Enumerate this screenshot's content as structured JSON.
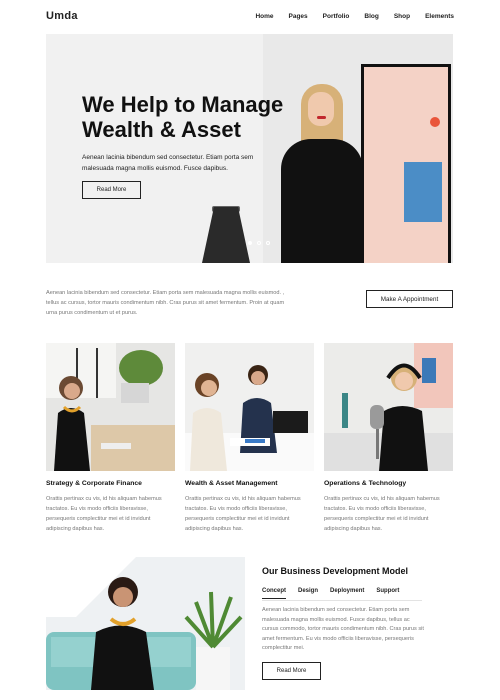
{
  "header": {
    "logo": "Umda",
    "nav": [
      "Home",
      "Pages",
      "Portfolio",
      "Blog",
      "Shop",
      "Elements"
    ]
  },
  "hero": {
    "title_line1": "We Help to Manage",
    "title_line2": "Wealth & Asset",
    "subtitle": "Aenean lacinia bibendum sed consectetur. Etiam porta sem malesuada magna mollis euismod. Fusce dapibus.",
    "button": "Read More",
    "slides": 3,
    "active_slide": 1
  },
  "intro": {
    "text": "Aenean lacinia bibendum sed consectetur. Etiam porta sem malesuada magna mollis euismod. , tellus ac cursus, tortor mauris condimentum nibh. Cras purus sit amet fermentum. Proin at quam urna purus condimentum ut et purus.",
    "button": "Make A Appointment"
  },
  "services": [
    {
      "title": "Strategy & Corporate Finance",
      "text": "Orattis pertinax cu vis, id his aliquam habemus tractatos. Eu vis modo officiis liberavisse, persequeris complectitur mei et id invidunt adipiscing dapibus has."
    },
    {
      "title": "Wealth & Asset Management",
      "text": "Orattis pertinax cu vis, id his aliquam habemus tractatos. Eu vis modo officiis liberavisse, persequeris complectitur mei et id invidunt adipiscing dapibus has."
    },
    {
      "title": "Operations & Technology",
      "text": "Orattis pertinax cu vis, id his aliquam habemus tractatos. Eu vis modo officiis liberavisse, persequeris complectitur mei et id invidunt adipiscing dapibus has."
    }
  ],
  "business": {
    "title": "Our Business Development Model",
    "tabs": [
      "Concept",
      "Design",
      "Deployment",
      "Support"
    ],
    "active_tab": "Concept",
    "text": "Aenean lacinia bibendum sed consectetur. Etiam porta sem malesuada magna mollis euismod. Fusce dapibus, tellus ac cursus commodo, tortor mauris condimentum nibh. Cras purus sit amet fermentum. Eu vis modo officiis liberavisse, persequeris complectitur mei.",
    "button": "Read More"
  }
}
